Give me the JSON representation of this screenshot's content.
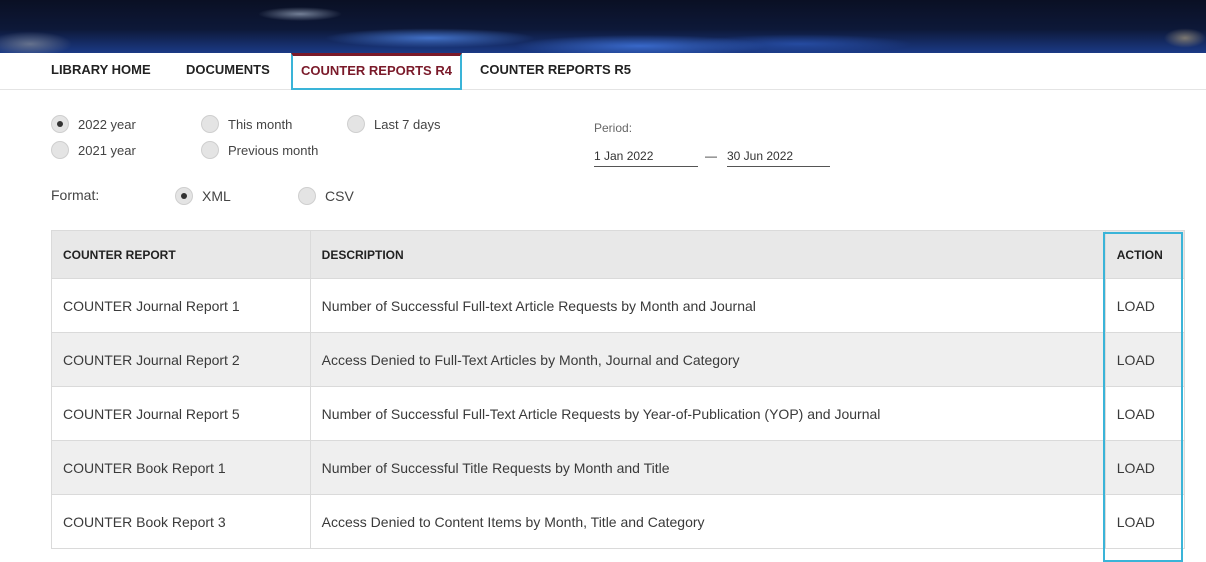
{
  "nav": {
    "items": [
      {
        "label": "LIBRARY HOME"
      },
      {
        "label": "DOCUMENTS"
      },
      {
        "label": "COUNTER REPORTS R4",
        "active": true
      },
      {
        "label": "COUNTER REPORTS R5"
      }
    ]
  },
  "period_options": [
    {
      "label": "2022 year",
      "checked": true
    },
    {
      "label": "This month",
      "checked": false
    },
    {
      "label": "Last 7 days",
      "checked": false
    },
    {
      "label": "2021 year",
      "checked": false
    },
    {
      "label": "Previous month",
      "checked": false
    }
  ],
  "period": {
    "label": "Period:",
    "from": "1 Jan 2022",
    "dash": "—",
    "to": "30 Jun 2022"
  },
  "format": {
    "label": "Format:",
    "options": [
      {
        "label": "XML",
        "checked": true
      },
      {
        "label": "CSV",
        "checked": false
      }
    ]
  },
  "table": {
    "headers": [
      "COUNTER REPORT",
      "DESCRIPTION",
      "ACTION"
    ],
    "rows": [
      {
        "report": "COUNTER Journal Report 1",
        "description": "Number of Successful Full-text Article Requests by Month and Journal",
        "action": "LOAD"
      },
      {
        "report": "COUNTER Journal Report 2",
        "description": "Access Denied to Full-Text Articles by Month, Journal and Category",
        "action": "LOAD"
      },
      {
        "report": "COUNTER Journal Report 5",
        "description": "Number of Successful Full-Text Article Requests by Year-of-Publication (YOP) and Journal",
        "action": "LOAD"
      },
      {
        "report": "COUNTER Book Report 1",
        "description": "Number of Successful Title Requests by Month and Title",
        "action": "LOAD"
      },
      {
        "report": "COUNTER Book Report 3",
        "description": "Access Denied to Content Items by Month, Title and Category",
        "action": "LOAD"
      }
    ]
  },
  "colors": {
    "accent": "#7a1a2a",
    "highlight": "#3ab4d8",
    "link": "#8a1f2e"
  }
}
